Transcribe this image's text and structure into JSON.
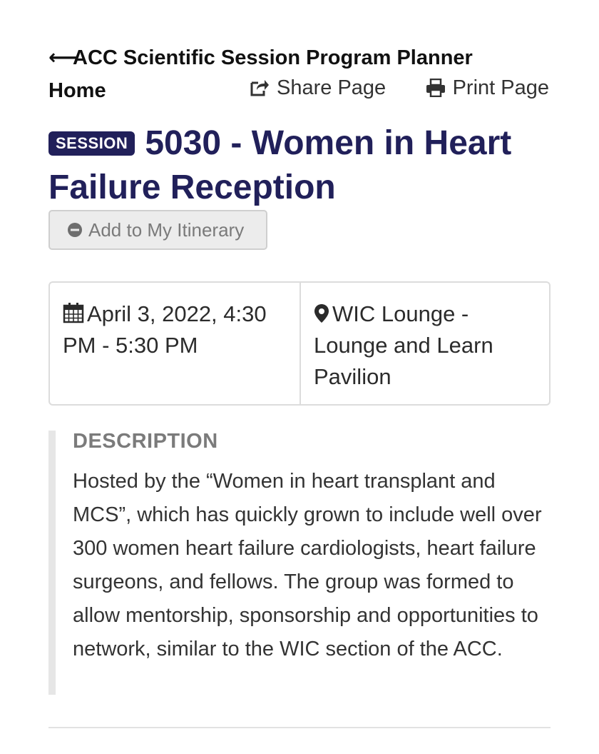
{
  "nav": {
    "back_arrow": "⟵",
    "back_label_line1": "ACC Scientific Session Program Planner",
    "back_label_line2": "Home"
  },
  "actions": {
    "share_label": "Share Page",
    "share_icon": "share-icon",
    "print_label": "Print Page",
    "print_icon": "print-icon"
  },
  "session": {
    "badge": "SESSION",
    "title": "5030 - Women in Heart Failure Reception"
  },
  "itinerary_button": {
    "label": "Add to My Itinerary",
    "icon": "minus-circle-icon"
  },
  "details": {
    "datetime": "April 3, 2022, 4:30 PM - 5:30 PM",
    "datetime_icon": "calendar-icon",
    "location": "WIC Lounge - Lounge and Learn Pavilion",
    "location_icon": "map-marker-icon"
  },
  "description": {
    "heading": "DESCRIPTION",
    "text": "Hosted by the “Women in heart transplant and MCS”, which has quickly grown to include well over 300 women heart failure cardiologists, heart failure surgeons, and fellows. The group was formed to allow mentorship, sponsorship and opportunities to network, similar to the WIC section of the ACC."
  },
  "colors": {
    "title": "#21205a",
    "badge_bg": "#21205a",
    "button_bg": "#ececec",
    "border": "#dcdcdc",
    "description_bar": "#e6e6e6"
  }
}
